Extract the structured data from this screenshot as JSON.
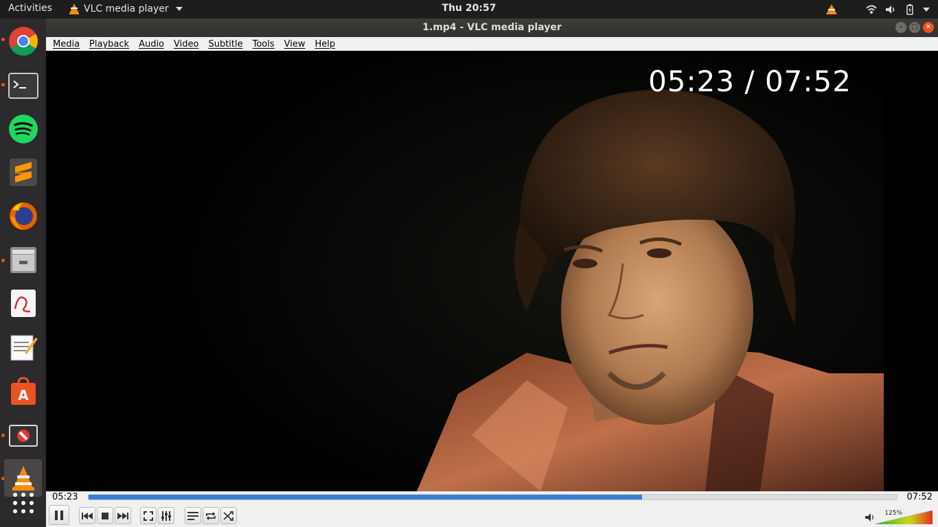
{
  "topbar": {
    "activities": "Activities",
    "app_name": "VLC media player",
    "clock": "Thu 20:57"
  },
  "window": {
    "title": "1.mp4 - VLC media player"
  },
  "menu": [
    "Media",
    "Playback",
    "Audio",
    "Video",
    "Subtitle",
    "Tools",
    "View",
    "Help"
  ],
  "video": {
    "osd_time": "05:23 / 07:52"
  },
  "seek": {
    "elapsed": "05:23",
    "total": "07:52",
    "progress": 0.685
  },
  "volume": {
    "label": "125%",
    "level": 1.25
  },
  "dock": [
    {
      "name": "chrome-icon",
      "running": true
    },
    {
      "name": "terminal-icon",
      "running": true
    },
    {
      "name": "spotify-icon",
      "running": false
    },
    {
      "name": "sublime-text-icon",
      "running": false
    },
    {
      "name": "firefox-icon",
      "running": false
    },
    {
      "name": "file-manager-icon",
      "running": true
    },
    {
      "name": "document-viewer-icon",
      "running": false
    },
    {
      "name": "text-editor-icon",
      "running": false
    },
    {
      "name": "software-center-icon",
      "running": false
    },
    {
      "name": "blocked-app-icon",
      "running": true
    },
    {
      "name": "vlc-icon",
      "running": true
    },
    {
      "name": "show-apps-icon",
      "running": false
    }
  ],
  "colors": {
    "accent": "#e95420",
    "progress": "#3a7dd6",
    "vlc_orange": "#f28c0f"
  }
}
